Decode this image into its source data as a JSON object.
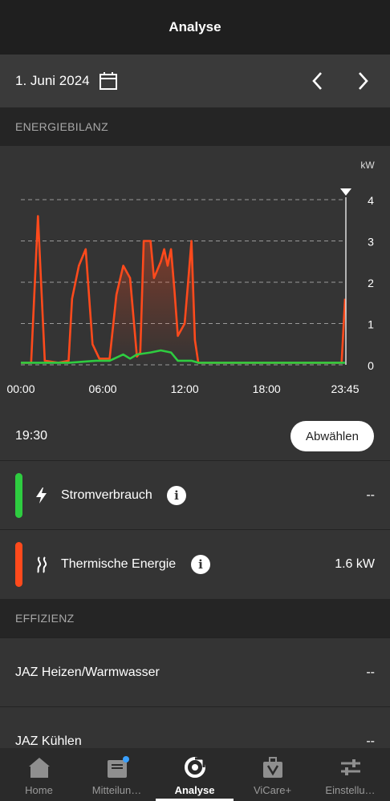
{
  "header": {
    "title": "Analyse"
  },
  "datebar": {
    "date": "1. Juni 2024"
  },
  "sections": {
    "energy": "ENERGIEBILANZ",
    "efficiency": "EFFIZIENZ"
  },
  "chart_data": {
    "type": "line",
    "unit_label": "kW",
    "ylim": [
      0,
      4
    ],
    "y_ticks": [
      "0",
      "1",
      "2",
      "3",
      "4"
    ],
    "x_ticks": [
      "00:00",
      "06:00",
      "12:00",
      "18:00",
      "23:45"
    ],
    "x_range_hours": [
      0,
      23.75
    ],
    "grid": true,
    "selected_time": "19:30",
    "series": [
      {
        "name": "Thermische Energie",
        "color": "#ff4a1c",
        "points": [
          [
            0,
            0.05
          ],
          [
            0.75,
            0.05
          ],
          [
            1.25,
            3.6
          ],
          [
            1.75,
            0.1
          ],
          [
            2.75,
            0.05
          ],
          [
            3.5,
            0.1
          ],
          [
            3.75,
            1.6
          ],
          [
            4.25,
            2.4
          ],
          [
            4.75,
            2.8
          ],
          [
            5.25,
            0.5
          ],
          [
            5.75,
            0.15
          ],
          [
            6.5,
            0.15
          ],
          [
            7.0,
            1.7
          ],
          [
            7.5,
            2.4
          ],
          [
            8.0,
            2.1
          ],
          [
            8.5,
            0.2
          ],
          [
            8.75,
            0.3
          ],
          [
            9.0,
            3.0
          ],
          [
            9.5,
            3.0
          ],
          [
            9.75,
            2.1
          ],
          [
            10.25,
            2.5
          ],
          [
            10.5,
            2.8
          ],
          [
            10.75,
            2.4
          ],
          [
            11.0,
            2.8
          ],
          [
            11.25,
            1.8
          ],
          [
            11.5,
            0.7
          ],
          [
            12.0,
            1.0
          ],
          [
            12.25,
            2.0
          ],
          [
            12.5,
            3.0
          ],
          [
            12.75,
            0.6
          ],
          [
            13.0,
            0.05
          ],
          [
            23.5,
            0.05
          ],
          [
            23.75,
            1.6
          ]
        ]
      },
      {
        "name": "Stromverbrauch",
        "color": "#2ecc40",
        "points": [
          [
            0,
            0.05
          ],
          [
            3.5,
            0.05
          ],
          [
            5.5,
            0.1
          ],
          [
            6.5,
            0.1
          ],
          [
            7.5,
            0.25
          ],
          [
            8.0,
            0.15
          ],
          [
            8.5,
            0.25
          ],
          [
            9.5,
            0.3
          ],
          [
            10.25,
            0.35
          ],
          [
            11.0,
            0.3
          ],
          [
            11.5,
            0.1
          ],
          [
            12.5,
            0.1
          ],
          [
            13.0,
            0.05
          ],
          [
            23.75,
            0.05
          ]
        ]
      }
    ]
  },
  "selection": {
    "time": "19:30",
    "deselect_label": "Abwählen"
  },
  "rows": {
    "power": {
      "label": "Stromverbrauch",
      "value": "--",
      "color": "#2ecc40",
      "icon": "bolt-icon"
    },
    "thermal": {
      "label": "Thermische Energie",
      "value": "1.6 kW",
      "color": "#ff4a1c",
      "icon": "heat-waves-icon"
    }
  },
  "efficiency": {
    "heating": {
      "label": "JAZ Heizen/Warmwasser",
      "value": "--"
    },
    "cooling": {
      "label": "JAZ Kühlen",
      "value": "--"
    }
  },
  "info_glyph": "i",
  "tabs": [
    {
      "label": "Home",
      "icon": "home-icon"
    },
    {
      "label": "Mitteilun…",
      "icon": "inbox-icon"
    },
    {
      "label": "Analyse",
      "icon": "analysis-icon"
    },
    {
      "label": "ViCare+",
      "icon": "bag-icon"
    },
    {
      "label": "Einstellu…",
      "icon": "sliders-icon"
    }
  ]
}
